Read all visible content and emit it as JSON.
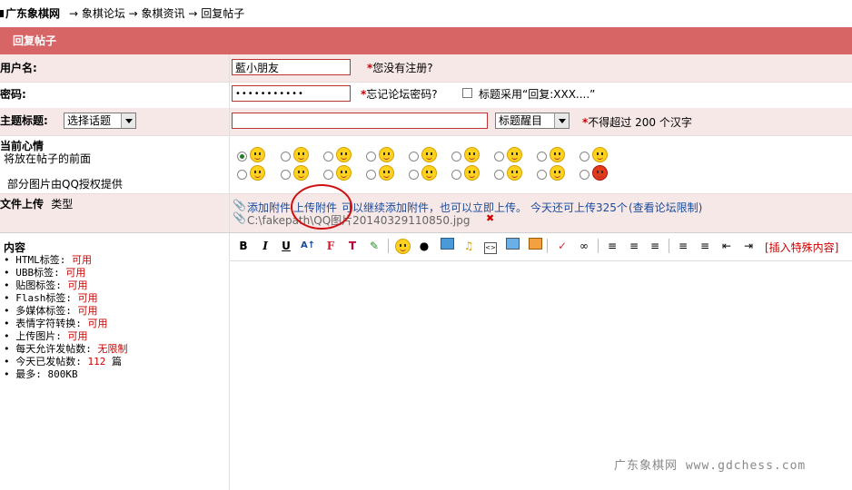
{
  "breadcrumb": {
    "site": "广东象棋网",
    "rest": "→ 象棋论坛 → 象棋资讯 → 回复帖子"
  },
  "title": "回复帖子",
  "username": {
    "label": "用户名:",
    "value": "藍小朋友",
    "note": "您没有注册?"
  },
  "password": {
    "label": "密码:",
    "value": "•••••••••••",
    "note": "忘记论坛密码?",
    "checkbox_label": "标题采用“回复:XXX....”"
  },
  "subject": {
    "label": "主题标题:",
    "topic_select": "选择话题",
    "value": "",
    "highlight_select": "标题醒目",
    "note": "不得超过 200 个汉字"
  },
  "mood": {
    "label": "当前心情",
    "desc1": "将放在帖子的前面",
    "desc2": "部分图片由QQ授权提供"
  },
  "upload": {
    "label": "文件上传",
    "type_label": "类型",
    "add_attach": "添加附件",
    "upload_attach": "上传附件",
    "msg": "可以继续添加附件，也可以立即上传。",
    "quota": "今天还可上传325个",
    "limit_link": "(查看论坛限制)",
    "file": "C:\\fakepath\\QQ图片20140329110850.jpg",
    "delete_icon": "✖"
  },
  "editor": {
    "special_content": "[插入特殊内容]",
    "toolbar": [
      "B",
      "I",
      "U"
    ]
  },
  "sidebar": {
    "title": "内容",
    "items": [
      {
        "label": "HTML标签:",
        "value": "可用"
      },
      {
        "label": "UBB标签:",
        "value": "可用"
      },
      {
        "label": "贴图标签:",
        "value": "可用"
      },
      {
        "label": "Flash标签:",
        "value": "可用"
      },
      {
        "label": "多媒体标签:",
        "value": "可用"
      },
      {
        "label": "表情字符转换:",
        "value": "可用"
      },
      {
        "label": "上传图片:",
        "value": "可用"
      },
      {
        "label": "每天允许发帖数:",
        "value": "无限制"
      },
      {
        "label": "今天已发帖数:",
        "value": "112",
        "suffix": "篇"
      },
      {
        "label": "最多:",
        "value": "800KB"
      }
    ]
  },
  "watermark": "广东象棋网 www.gdchess.com",
  "colors": {
    "titlebar": "#d86565",
    "row_pink": "#f7e8e8",
    "link": "#1a4a9a",
    "accent_red": "#cc0000"
  }
}
